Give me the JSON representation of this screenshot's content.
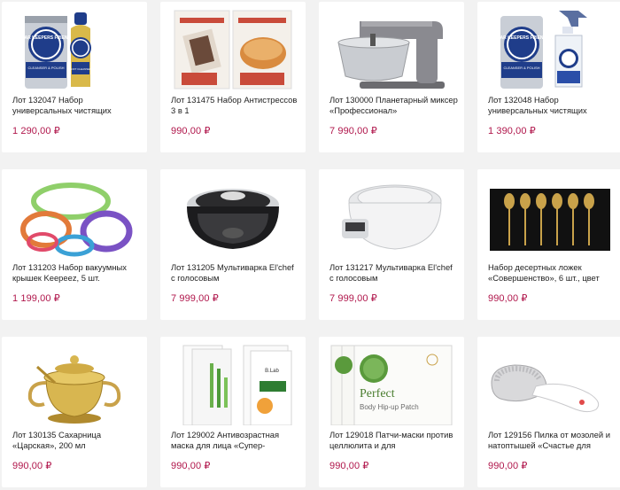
{
  "products": [
    {
      "title": "Лот 132047 Набор универсальных чистящих",
      "price": "1 290,00 ₽",
      "icon": "cleaner-cans-icon",
      "brand": "BAR KEEPERS FRIEND",
      "sub1": "CLEANSER & POLISH",
      "sub2": "SOFT CLEANSER"
    },
    {
      "title": "Лот 131475 Набор Антистрессов 3 в 1",
      "price": "990,00 ₽",
      "icon": "antistress-set-icon",
      "brand": ""
    },
    {
      "title": "Лот 130000 Планетарный миксер «Профессионал»",
      "price": "7 990,00 ₽",
      "icon": "stand-mixer-icon"
    },
    {
      "title": "Лот 132048 Набор универсальных чистящих",
      "price": "1 390,00 ₽",
      "icon": "cleaner-spray-icon",
      "brand": "BAR KEEPERS FRIEND",
      "sub1": "CLEANSER & POLISH"
    },
    {
      "title": "Лот 131203 Набор вакуумных крышек Keepeez, 5 шт.",
      "price": "1 199,00 ₽",
      "icon": "vacuum-lids-icon"
    },
    {
      "title": "Лот 131205 Мультиварка El'chef с голосовым",
      "price": "7 999,00 ₽",
      "icon": "multicooker-black-icon"
    },
    {
      "title": "Лот 131217 Мультиварка El'chef с голосовым",
      "price": "7 999,00 ₽",
      "icon": "multicooker-white-icon"
    },
    {
      "title": "Набор десертных ложек «Совершенство», 6 шт., цвет",
      "price": "990,00 ₽",
      "icon": "dessert-spoons-icon"
    },
    {
      "title": "Лот 130135 Сахарница «Царская», 200 мл",
      "price": "990,00 ₽",
      "icon": "sugar-bowl-icon"
    },
    {
      "title": "Лот 129002 Антивозрастная маска для лица «Супер-",
      "price": "990,00 ₽",
      "icon": "face-mask-icon",
      "brand": "B.Lab"
    },
    {
      "title": "Лот 129018 Патчи-маски против целлюлита и для",
      "price": "990,00 ₽",
      "icon": "hip-patch-icon",
      "brand": "Perfect",
      "sub1": "Body Hip-up Patch"
    },
    {
      "title": "Лот 129156 Пилка от мозолей и натоптышей «Счастье для",
      "price": "990,00 ₽",
      "icon": "foot-file-icon"
    }
  ]
}
